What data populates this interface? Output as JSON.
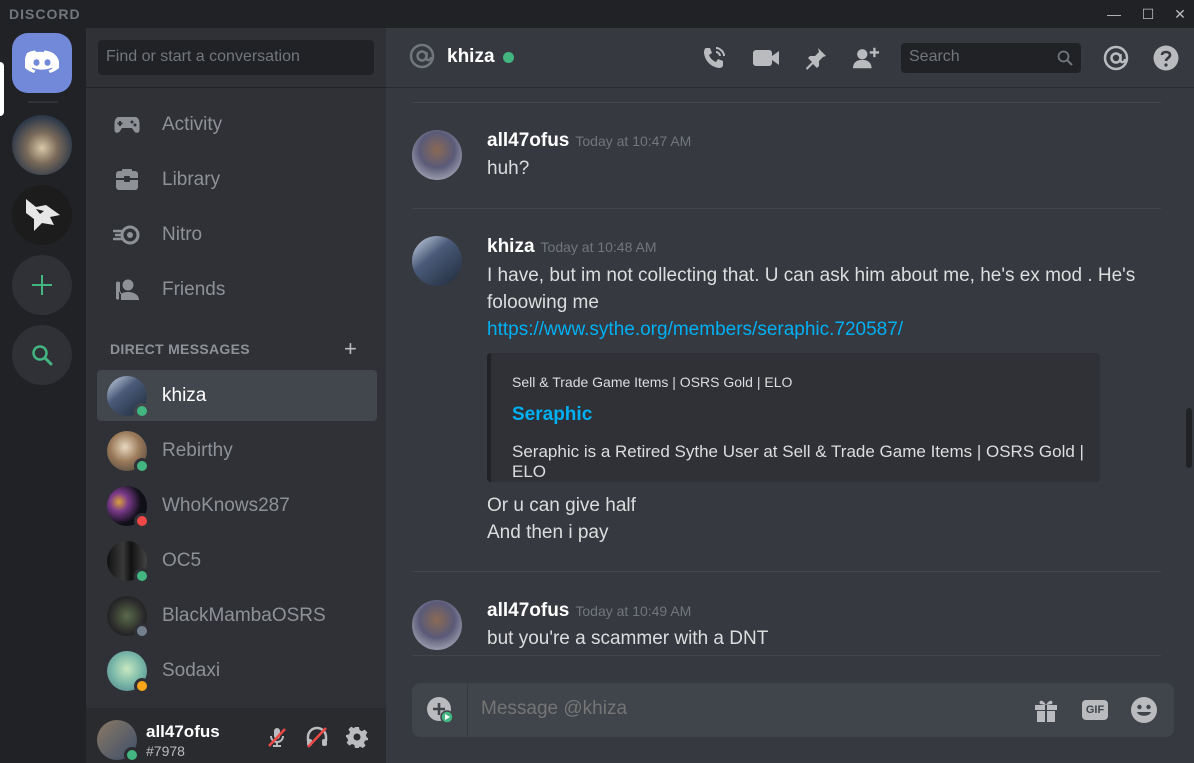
{
  "app": {
    "brand": "DISCORD"
  },
  "window_controls": {
    "minimize": "—",
    "maximize": "☐",
    "close": "✕"
  },
  "sidebar": {
    "search_placeholder": "Find or start a conversation",
    "nav": [
      {
        "label": "Activity",
        "icon": "gamepad-icon"
      },
      {
        "label": "Library",
        "icon": "library-icon"
      },
      {
        "label": "Nitro",
        "icon": "nitro-icon"
      },
      {
        "label": "Friends",
        "icon": "friends-icon"
      }
    ],
    "dm_header": "DIRECT MESSAGES",
    "dm_add": "+",
    "dms": [
      {
        "name": "khiza",
        "status": "online",
        "active": true
      },
      {
        "name": "Rebirthy",
        "status": "online"
      },
      {
        "name": "WhoKnows287",
        "status": "dnd"
      },
      {
        "name": "OC5",
        "status": "online"
      },
      {
        "name": "BlackMambaOSRS",
        "status": "offline"
      },
      {
        "name": "Sodaxi",
        "status": "idle"
      }
    ],
    "user": {
      "name": "all47ofus",
      "tag": "#7978"
    }
  },
  "chat": {
    "channel_name": "khiza",
    "search_placeholder": "Search",
    "composer_placeholder": "Message @khiza",
    "messages": [
      {
        "author": "all47ofus",
        "time": "Today at 10:47 AM",
        "lines": [
          "huh?"
        ]
      },
      {
        "author": "khiza",
        "time": "Today at 10:48 AM",
        "lines": [
          "I have, but im not collecting that. U can ask him about me, he's ex mod . He's",
          "foloowing me"
        ],
        "link": "https://www.sythe.org/members/seraphic.720587/",
        "embed": {
          "provider": "Sell & Trade Game Items | OSRS Gold | ELO",
          "title": "Seraphic",
          "description": "Seraphic is a Retired Sythe User at Sell & Trade Game Items | OSRS Gold | ELO"
        },
        "after_lines": [
          "Or u can give half",
          "And then i pay"
        ]
      },
      {
        "author": "all47ofus",
        "time": "Today at 10:49 AM",
        "lines": [
          "but you're a scammer with a DNT"
        ]
      }
    ]
  },
  "colors": {
    "blurple": "#7289da",
    "online": "#43b581",
    "dnd": "#f04747",
    "idle": "#faa61a",
    "link": "#00b0f4",
    "green_accent": "#43b581"
  }
}
